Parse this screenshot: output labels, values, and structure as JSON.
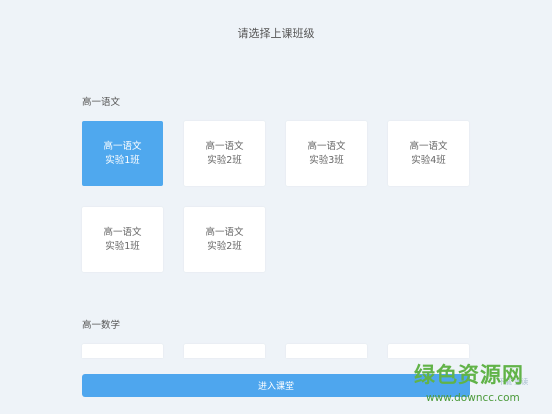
{
  "header": {
    "title": "请选择上课班级"
  },
  "sections": [
    {
      "title": "高一语文",
      "classes": [
        {
          "line1": "高一语文",
          "line2": "实验1班",
          "selected": true
        },
        {
          "line1": "高一语文",
          "line2": "实验2班",
          "selected": false
        },
        {
          "line1": "高一语文",
          "line2": "实验3班",
          "selected": false
        },
        {
          "line1": "高一语文",
          "line2": "实验4班",
          "selected": false
        },
        {
          "line1": "高一语文",
          "line2": "实验1班",
          "selected": false
        },
        {
          "line1": "高一语文",
          "line2": "实验2班",
          "selected": false
        }
      ]
    },
    {
      "title": "高一数学",
      "classes": [
        {},
        {},
        {},
        {}
      ]
    }
  ],
  "footer": {
    "enter_label": "进入课堂"
  },
  "watermark": {
    "text": "绿色资源网",
    "url": "www.downcc.com",
    "small": "下载 速读"
  },
  "colors": {
    "accent": "#4fa8ee",
    "background": "#eef3f8",
    "watermark": "#61b348"
  }
}
